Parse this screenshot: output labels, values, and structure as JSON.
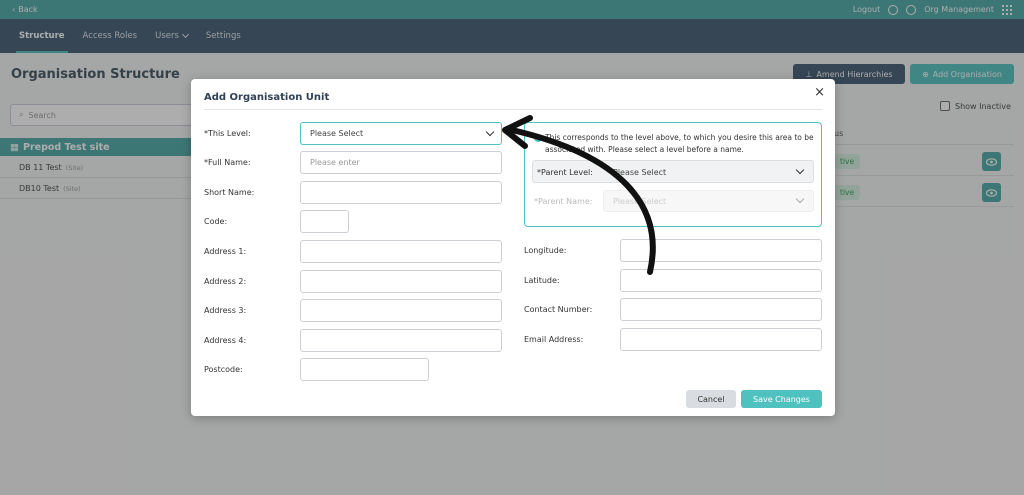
{
  "topbar": {
    "back_label": "Back",
    "logout_label": "Logout",
    "org_label": "Org Management",
    "accent_color": "#4aa7a5"
  },
  "nav": {
    "tabs": [
      {
        "label": "Structure"
      },
      {
        "label": "Access Roles"
      },
      {
        "label": "Users"
      },
      {
        "label": "Settings"
      }
    ]
  },
  "page": {
    "title": "Organisation Structure",
    "amend_label": "Amend Hierarchies",
    "add_org_label": "Add Organisation",
    "search_placeholder": "Search",
    "site_title": "Prepod Test site",
    "items": [
      {
        "label": "DB 11 Test",
        "tag": "(Site)"
      },
      {
        "label": "DB10 Test",
        "tag": "(Site)"
      }
    ],
    "show_inactive_label": "Show Inactive",
    "column_fragment": "us",
    "rows": [
      {
        "status": "tive"
      },
      {
        "status": "tive"
      }
    ]
  },
  "modal": {
    "title": "Add Organisation Unit",
    "left_fields": [
      {
        "label": "*This Level:",
        "value": "Please Select"
      },
      {
        "label": "*Full Name:",
        "placeholder": "Please enter"
      },
      {
        "label": "Short Name:"
      },
      {
        "label": "Code:"
      },
      {
        "label": "Address 1:"
      },
      {
        "label": "Address 2:"
      },
      {
        "label": "Address 3:"
      },
      {
        "label": "Address 4:"
      },
      {
        "label": "Postcode:"
      }
    ],
    "info_text": "This corresponds to the level above, to which you desire this area to be associated with. Please select a level before a name.",
    "parent_level_label": "*Parent Level:",
    "parent_level_value": "Please Select",
    "parent_name_label": "*Parent Name:",
    "parent_name_value": "Please Select",
    "right_fields": [
      {
        "label": "Longitude:"
      },
      {
        "label": "Latitude:"
      },
      {
        "label": "Contact Number:"
      },
      {
        "label": "Email Address:"
      }
    ],
    "cancel_label": "Cancel",
    "save_label": "Save Changes"
  }
}
